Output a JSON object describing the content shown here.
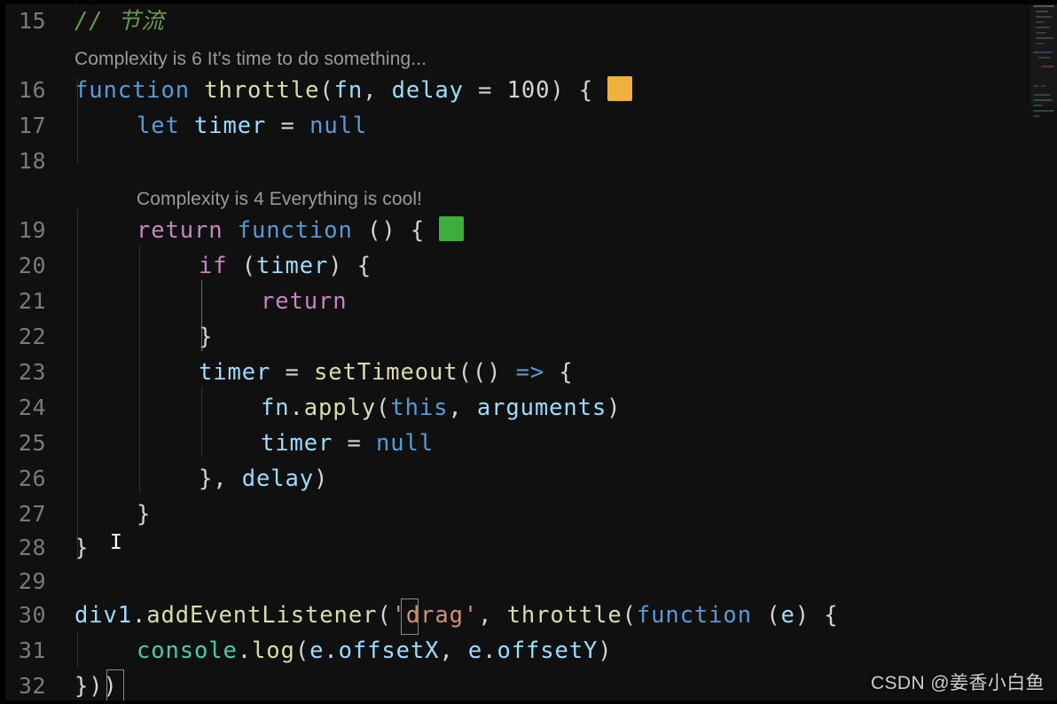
{
  "editor": {
    "theme_name": "dark-plus",
    "background": "#101010",
    "language": "javascript",
    "colors": {
      "line_number": "#7a7a7a",
      "foreground": "#d4d4d4",
      "keyword": "#569cd6",
      "control": "#c586c0",
      "function": "#dcdcaa",
      "variable": "#9cdcfe",
      "string": "#ce9178",
      "number": "#b5cea8",
      "class": "#4ec9b0",
      "comment": "#6a9955",
      "indent_guide": "#2f3437",
      "indent_guide_active": "#707070",
      "codelens": "#9a9a9a",
      "complexity_warn": "#f0b23a",
      "complexity_ok": "#3dad3d",
      "bracket_match_border": "#8a8a8a"
    }
  },
  "codelens": [
    {
      "id": "lens-line-16",
      "text": "Complexity is 6 It's time to do something...",
      "complexity": 6
    },
    {
      "id": "lens-line-19",
      "text": "Complexity is 4 Everything is cool!",
      "complexity": 4
    }
  ],
  "complexity_markers": [
    {
      "id": "marker-line-16",
      "line": 16,
      "color": "#f0b23a",
      "level": "warn"
    },
    {
      "id": "marker-line-19",
      "line": 19,
      "color": "#3dad3d",
      "level": "ok"
    }
  ],
  "lines": [
    {
      "number": "15",
      "text": "// 节流"
    },
    {
      "number": "16",
      "text": "function throttle(fn, delay = 100) { "
    },
    {
      "number": "17",
      "text": "    let timer = null"
    },
    {
      "number": "18",
      "text": ""
    },
    {
      "number": "19",
      "text": "    return function () { "
    },
    {
      "number": "20",
      "text": "        if (timer) {"
    },
    {
      "number": "21",
      "text": "            return"
    },
    {
      "number": "22",
      "text": "        }"
    },
    {
      "number": "23",
      "text": "        timer = setTimeout(() => {"
    },
    {
      "number": "24",
      "text": "            fn.apply(this, arguments)"
    },
    {
      "number": "25",
      "text": "            timer = null"
    },
    {
      "number": "26",
      "text": "        }, delay)"
    },
    {
      "number": "27",
      "text": "    }"
    },
    {
      "number": "28",
      "text": "}"
    },
    {
      "number": "29",
      "text": ""
    },
    {
      "number": "30",
      "text": "div1.addEventListener('drag', throttle(function (e) {"
    },
    {
      "number": "31",
      "text": "    console.log(e.offsetX, e.offsetY)"
    },
    {
      "number": "32",
      "text": "}))"
    }
  ],
  "tokens": {
    "l15": [
      {
        "t": "// ",
        "c": "comment"
      },
      {
        "t": "节流",
        "c": "comment"
      }
    ],
    "l16": [
      {
        "t": "function",
        "c": "key"
      },
      {
        "t": " ",
        "c": "plain"
      },
      {
        "t": "throttle",
        "c": "fn"
      },
      {
        "t": "(",
        "c": "plain"
      },
      {
        "t": "fn",
        "c": "var"
      },
      {
        "t": ", ",
        "c": "plain"
      },
      {
        "t": "delay",
        "c": "var"
      },
      {
        "t": " = ",
        "c": "plain"
      },
      {
        "t": "100",
        "c": "plain"
      },
      {
        "t": ") { ",
        "c": "plain"
      }
    ],
    "l17": [
      {
        "t": "let",
        "c": "key"
      },
      {
        "t": " ",
        "c": "plain"
      },
      {
        "t": "timer",
        "c": "var"
      },
      {
        "t": " = ",
        "c": "plain"
      },
      {
        "t": "null",
        "c": "key"
      }
    ],
    "l19": [
      {
        "t": "return",
        "c": "ctrl"
      },
      {
        "t": " ",
        "c": "plain"
      },
      {
        "t": "function",
        "c": "key"
      },
      {
        "t": " () { ",
        "c": "plain"
      }
    ],
    "l20": [
      {
        "t": "if",
        "c": "ctrl"
      },
      {
        "t": " (",
        "c": "plain"
      },
      {
        "t": "timer",
        "c": "var"
      },
      {
        "t": ") {",
        "c": "plain"
      }
    ],
    "l21": [
      {
        "t": "return",
        "c": "ctrl"
      }
    ],
    "l22": [
      {
        "t": "}",
        "c": "plain"
      }
    ],
    "l23": [
      {
        "t": "timer",
        "c": "var"
      },
      {
        "t": " = ",
        "c": "plain"
      },
      {
        "t": "setTimeout",
        "c": "fn"
      },
      {
        "t": "(() ",
        "c": "plain"
      },
      {
        "t": "=>",
        "c": "key"
      },
      {
        "t": " {",
        "c": "plain"
      }
    ],
    "l24": [
      {
        "t": "fn",
        "c": "var"
      },
      {
        "t": ".",
        "c": "plain"
      },
      {
        "t": "apply",
        "c": "fn"
      },
      {
        "t": "(",
        "c": "plain"
      },
      {
        "t": "this",
        "c": "key"
      },
      {
        "t": ", ",
        "c": "plain"
      },
      {
        "t": "arguments",
        "c": "var"
      },
      {
        "t": ")",
        "c": "plain"
      }
    ],
    "l25": [
      {
        "t": "timer",
        "c": "var"
      },
      {
        "t": " = ",
        "c": "plain"
      },
      {
        "t": "null",
        "c": "key"
      }
    ],
    "l26": [
      {
        "t": "}, ",
        "c": "plain"
      },
      {
        "t": "delay",
        "c": "var"
      },
      {
        "t": ")",
        "c": "plain"
      }
    ],
    "l27": [
      {
        "t": "}",
        "c": "plain"
      }
    ],
    "l28": [
      {
        "t": "}",
        "c": "plain"
      }
    ],
    "l30": [
      {
        "t": "div1",
        "c": "var"
      },
      {
        "t": ".",
        "c": "plain"
      },
      {
        "t": "addEventListener",
        "c": "fn"
      },
      {
        "t": "(",
        "c": "plain"
      },
      {
        "t": "'drag'",
        "c": "str"
      },
      {
        "t": ", ",
        "c": "plain"
      },
      {
        "t": "throttle",
        "c": "fn"
      },
      {
        "t": "(",
        "c": "plain"
      },
      {
        "t": "function",
        "c": "key"
      },
      {
        "t": " (",
        "c": "plain"
      },
      {
        "t": "e",
        "c": "var"
      },
      {
        "t": ") {",
        "c": "plain"
      }
    ],
    "l31": [
      {
        "t": "console",
        "c": "cls"
      },
      {
        "t": ".",
        "c": "plain"
      },
      {
        "t": "log",
        "c": "fn"
      },
      {
        "t": "(",
        "c": "plain"
      },
      {
        "t": "e",
        "c": "var"
      },
      {
        "t": ".",
        "c": "plain"
      },
      {
        "t": "offsetX",
        "c": "var"
      },
      {
        "t": ", ",
        "c": "plain"
      },
      {
        "t": "e",
        "c": "var"
      },
      {
        "t": ".",
        "c": "plain"
      },
      {
        "t": "offsetY",
        "c": "var"
      },
      {
        "t": ")",
        "c": "plain"
      }
    ],
    "l32": [
      {
        "t": "})",
        "c": "plain"
      },
      {
        "t": ")",
        "c": "plain"
      }
    ]
  },
  "bracket_matches": [
    {
      "id": "bracket-open-line-30",
      "label": "("
    },
    {
      "id": "bracket-close-line-32",
      "label": ")"
    }
  ],
  "mouse_cursor": {
    "type": "text-ibeam",
    "glyph": "I"
  },
  "watermark": {
    "text": "CSDN @姜香小白鱼"
  }
}
